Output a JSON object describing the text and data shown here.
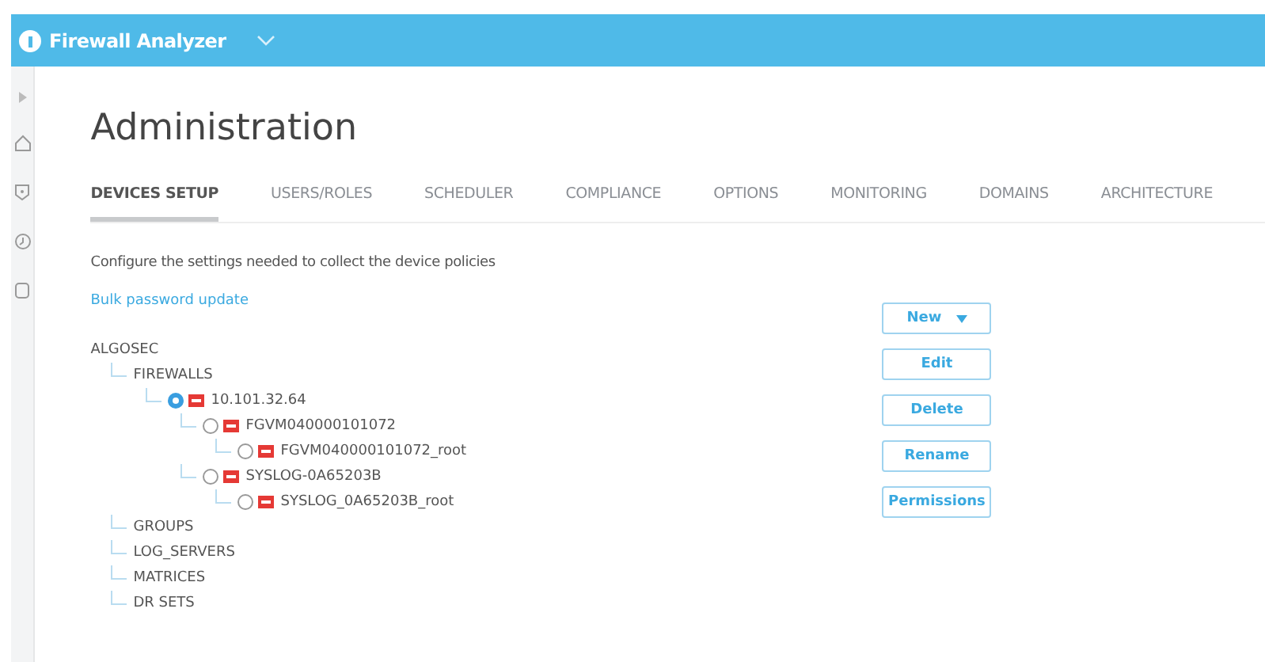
{
  "app": {
    "title": "Firewall Analyzer"
  },
  "page": {
    "title": "Administration"
  },
  "tabs": [
    {
      "label": "DEVICES SETUP",
      "selected": true
    },
    {
      "label": "USERS/ROLES",
      "selected": false
    },
    {
      "label": "SCHEDULER",
      "selected": false
    },
    {
      "label": "COMPLIANCE",
      "selected": false
    },
    {
      "label": "OPTIONS",
      "selected": false
    },
    {
      "label": "MONITORING",
      "selected": false
    },
    {
      "label": "DOMAINS",
      "selected": false
    },
    {
      "label": "ARCHITECTURE",
      "selected": false
    }
  ],
  "description": "Configure the settings needed to collect the device policies",
  "bulk_link": "Bulk password update",
  "tree": {
    "label": "ALGOSEC",
    "kind": "folder",
    "children": [
      {
        "label": "FIREWALLS",
        "kind": "folder",
        "children": [
          {
            "label": "10.101.32.64",
            "kind": "device",
            "selected": true,
            "children": [
              {
                "label": "FGVM040000101072",
                "kind": "device",
                "selected": false,
                "children": [
                  {
                    "label": "FGVM040000101072_root",
                    "kind": "device",
                    "selected": false
                  }
                ]
              },
              {
                "label": "SYSLOG-0A65203B",
                "kind": "device",
                "selected": false,
                "children": [
                  {
                    "label": "SYSLOG_0A65203B_root",
                    "kind": "device",
                    "selected": false
                  }
                ]
              }
            ]
          }
        ]
      },
      {
        "label": "GROUPS",
        "kind": "folder"
      },
      {
        "label": "LOG_SERVERS",
        "kind": "folder"
      },
      {
        "label": "MATRICES",
        "kind": "folder"
      },
      {
        "label": "DR SETS",
        "kind": "folder"
      }
    ]
  },
  "actions": [
    {
      "label": "New",
      "kind": "dropdown"
    },
    {
      "label": "Edit",
      "kind": "plain"
    },
    {
      "label": "Delete",
      "kind": "plain"
    },
    {
      "label": "Rename",
      "kind": "plain"
    },
    {
      "label": "Permissions",
      "kind": "plain"
    }
  ]
}
